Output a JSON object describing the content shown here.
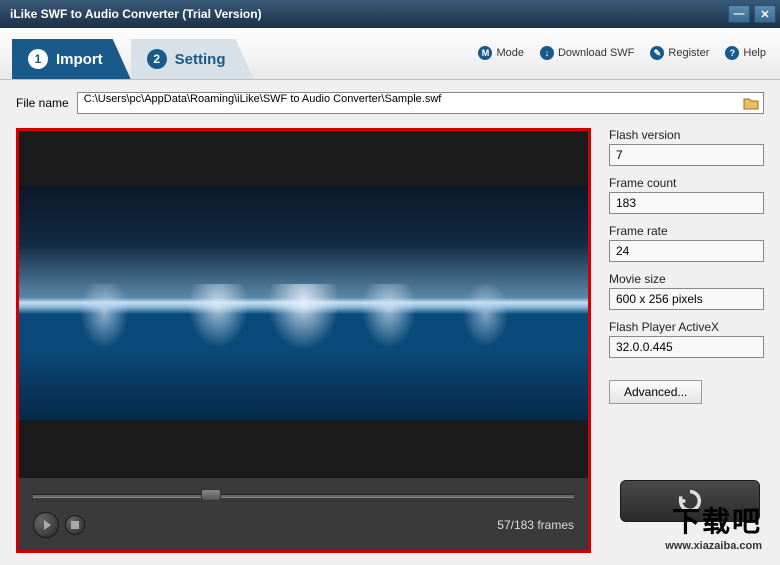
{
  "window": {
    "title": "iLike SWF to Audio Converter (Trial Version)"
  },
  "topLinks": {
    "mode": "Mode",
    "download": "Download SWF",
    "register": "Register",
    "help": "Help"
  },
  "tabs": {
    "import": {
      "num": "1",
      "label": "Import"
    },
    "setting": {
      "num": "2",
      "label": "Setting"
    }
  },
  "file": {
    "label": "File name",
    "path": "C:\\Users\\pc\\AppData\\Roaming\\iLike\\SWF to Audio Converter\\Sample.swf"
  },
  "player": {
    "frameCounter": "57/183 frames"
  },
  "info": {
    "flashVersion": {
      "label": "Flash version",
      "value": "7"
    },
    "frameCount": {
      "label": "Frame count",
      "value": "183"
    },
    "frameRate": {
      "label": "Frame rate",
      "value": "24"
    },
    "movieSize": {
      "label": "Movie size",
      "value": "600 x 256 pixels"
    },
    "activeX": {
      "label": "Flash Player ActiveX",
      "value": "32.0.0.445"
    }
  },
  "buttons": {
    "advanced": "Advanced..."
  },
  "watermark": {
    "big": "下载吧",
    "small": "www.xiazaiba.com"
  }
}
